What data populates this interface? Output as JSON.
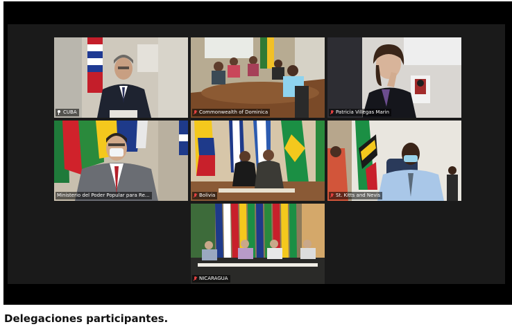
{
  "meeting": {
    "tiles": [
      {
        "name": "CUBA",
        "active": true,
        "indicator": "pin-icon"
      },
      {
        "name": "Commonwealth of Dominica",
        "active": false,
        "indicator": "mic-muted-icon"
      },
      {
        "name": "Patricia Villegas Marin",
        "active": false,
        "indicator": "mic-muted-icon"
      },
      {
        "name": "Ministerio del Poder Popular para Re...",
        "active": false,
        "indicator": "none"
      },
      {
        "name": "Bolivia",
        "active": false,
        "indicator": "mic-muted-icon"
      },
      {
        "name": "St. Kitts and Nevis",
        "active": false,
        "indicator": "mic-muted-icon"
      },
      {
        "name": "NICARAGUA",
        "active": false,
        "indicator": "mic-muted-icon"
      }
    ],
    "colors": {
      "active_border": "#d9f25a",
      "muted_mic": "#e04040",
      "background": "#000000"
    }
  },
  "caption": "Delegaciones participantes."
}
